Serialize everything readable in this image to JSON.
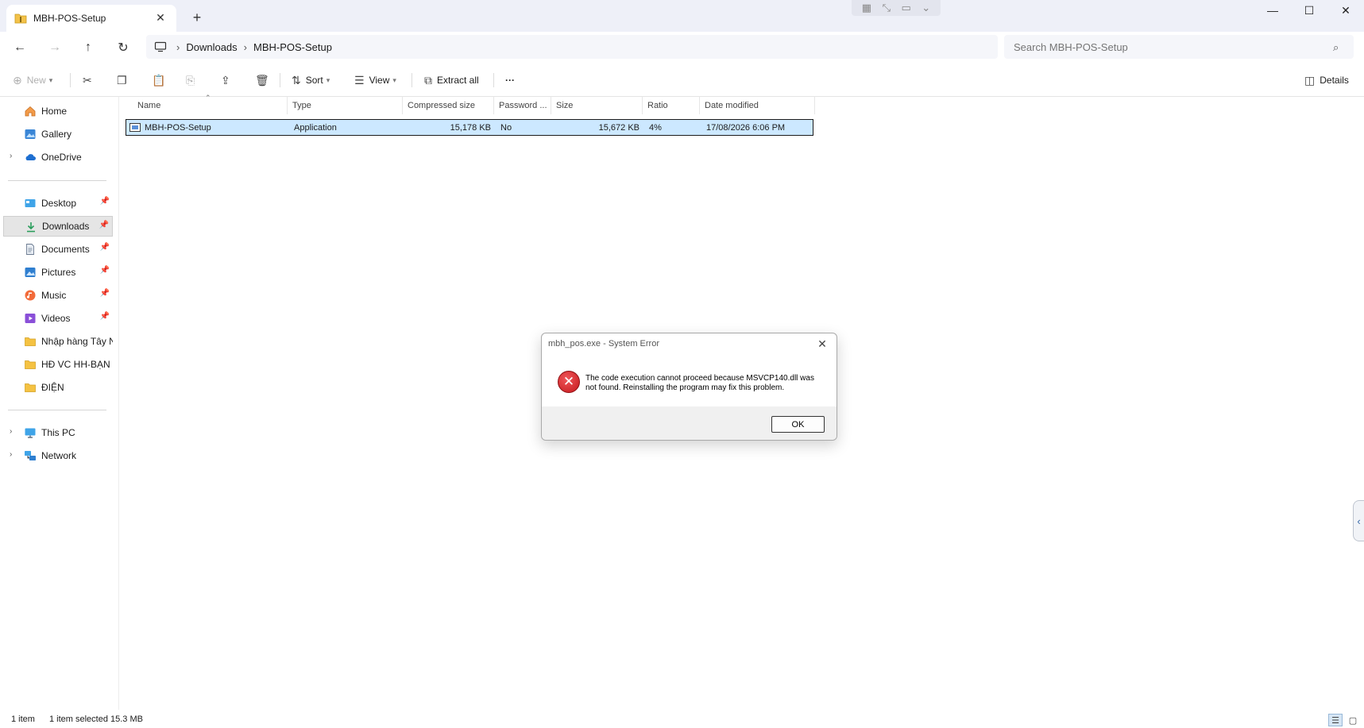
{
  "window": {
    "tab_title": "MBH-POS-Setup",
    "tab_close": "✕",
    "new_tab": "+",
    "minimize": "—",
    "maximize": "☐",
    "close": "✕"
  },
  "remote_bar": {
    "icons": [
      "grid-icon",
      "resize-icon",
      "monitor-icon",
      "chevron-down-icon"
    ]
  },
  "address": {
    "crumbs": [
      "Downloads",
      "MBH-POS-Setup"
    ],
    "search_placeholder": "Search MBH-POS-Setup"
  },
  "command_bar": {
    "new_label": "New",
    "sort_label": "Sort",
    "view_label": "View",
    "extract_label": "Extract all",
    "more_label": "···",
    "details_label": "Details"
  },
  "sidebar": {
    "top": [
      {
        "label": "Home",
        "icon": "home-icon"
      },
      {
        "label": "Gallery",
        "icon": "gallery-icon"
      },
      {
        "label": "OneDrive",
        "icon": "cloud-icon"
      }
    ],
    "quick": [
      {
        "label": "Desktop",
        "icon": "desktop-icon"
      },
      {
        "label": "Downloads",
        "icon": "download-icon",
        "selected": true
      },
      {
        "label": "Documents",
        "icon": "document-icon"
      },
      {
        "label": "Pictures",
        "icon": "picture-icon"
      },
      {
        "label": "Music",
        "icon": "music-icon"
      },
      {
        "label": "Videos",
        "icon": "video-icon"
      },
      {
        "label": "Nhập hàng Tây Nam",
        "icon": "folder-icon"
      },
      {
        "label": "HĐ VC HH-BẠN CH",
        "icon": "folder-icon"
      },
      {
        "label": "ĐIỆN",
        "icon": "folder-icon"
      }
    ],
    "bottom": [
      {
        "label": "This PC",
        "icon": "computer-icon"
      },
      {
        "label": "Network",
        "icon": "network-icon"
      }
    ]
  },
  "columns": [
    "Name",
    "Type",
    "Compressed size",
    "Password ...",
    "Size",
    "Ratio",
    "Date modified"
  ],
  "files": [
    {
      "name": "MBH-POS-Setup",
      "type": "Application",
      "compressed_size": "15,178 KB",
      "password": "No",
      "size": "15,672 KB",
      "ratio": "4%",
      "date_modified": "17/08/2026 6:06 PM"
    }
  ],
  "dialog": {
    "title": "mbh_pos.exe - System Error",
    "message": "The code execution cannot proceed because MSVCP140.dll was not found. Reinstalling the program may fix this problem.",
    "ok_label": "OK",
    "close": "✕",
    "icon_glyph": "✕"
  },
  "status": {
    "item_count": "1 item",
    "selection": "1 item selected  15.3 MB"
  },
  "colors": {
    "selection_bg": "#cce8ff",
    "error_red": "#c4181c",
    "title_bg": "#eef0f8"
  }
}
